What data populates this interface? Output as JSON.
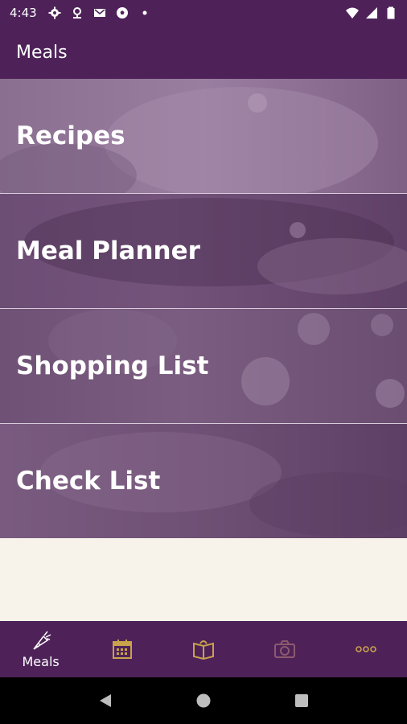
{
  "status_bar": {
    "time": "4:43",
    "left_icons": [
      "settings-icon",
      "location-icon",
      "mail-icon",
      "soccer-icon",
      "dot-icon"
    ],
    "right_icons": [
      "wifi-icon",
      "signal-icon",
      "battery-icon"
    ]
  },
  "app_bar": {
    "title": "Meals"
  },
  "menu": {
    "items": [
      {
        "label": "Recipes"
      },
      {
        "label": "Meal Planner"
      },
      {
        "label": "Shopping List"
      },
      {
        "label": "Check List"
      }
    ]
  },
  "bottom_nav": {
    "tabs": [
      {
        "label": "Meals",
        "icon": "carrot-icon",
        "active": true
      },
      {
        "label": "",
        "icon": "calendar-icon"
      },
      {
        "label": "",
        "icon": "book-icon"
      },
      {
        "label": "",
        "icon": "camera-icon"
      },
      {
        "label": "",
        "icon": "more-icon"
      }
    ]
  },
  "colors": {
    "primary": "#4e2259",
    "accent": "#c9a24b",
    "background": "#f7f2ea"
  }
}
